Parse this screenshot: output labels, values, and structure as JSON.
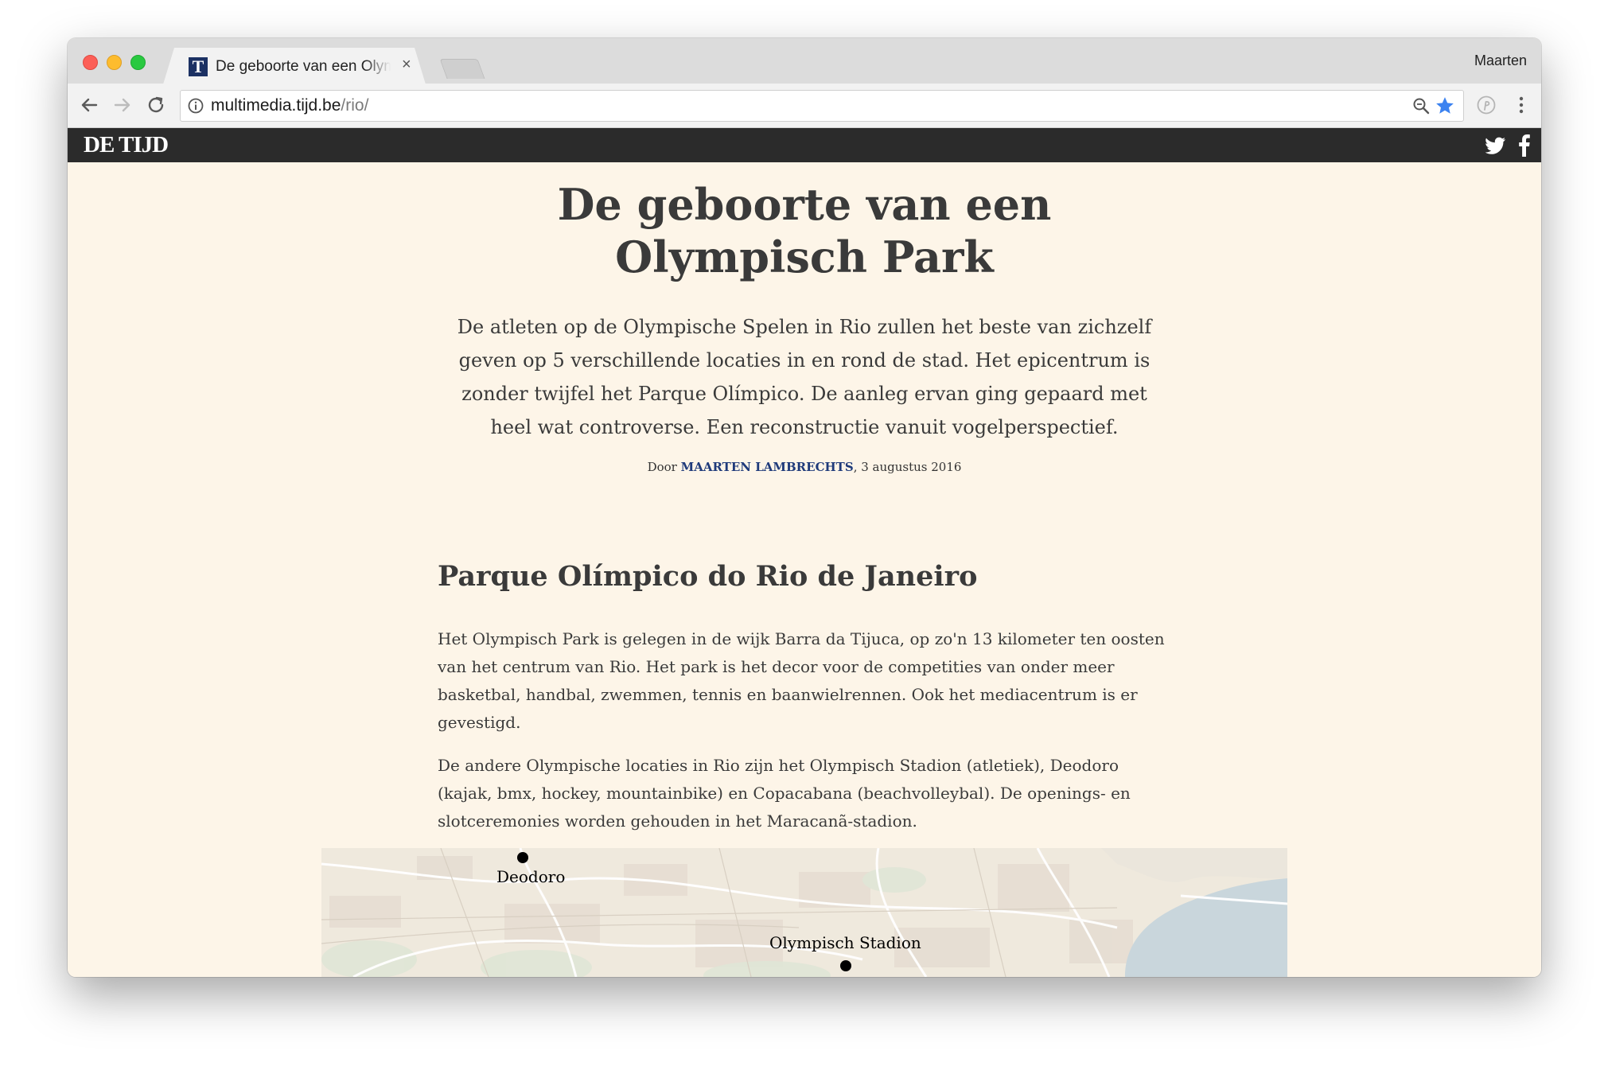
{
  "browser": {
    "tab_title": "De geboorte van een Olympisch Park",
    "tab_close": "×",
    "favicon_letter": "T",
    "profile_name": "Maarten",
    "url_host": "multimedia.tijd.be",
    "url_path": "/rio/"
  },
  "site": {
    "logo": "DE TIJD",
    "social": [
      "twitter-icon",
      "facebook-icon"
    ]
  },
  "article": {
    "headline": "De geboorte van een Olympisch Park",
    "intro": "De atleten op de Olympische Spelen in Rio zullen het beste van zichzelf geven op 5 verschillende locaties in en rond de stad. Het epicentrum is zonder twijfel het Parque Olímpico. De aanleg ervan ging gepaard met heel wat controverse. Een reconstructie vanuit vogelperspectief.",
    "byline_prefix": "Door ",
    "byline_author": "MAARTEN LAMBRECHTS",
    "byline_date": ", 3 augustus 2016",
    "section_title": "Parque Olímpico do Rio de Janeiro",
    "paragraph_1": "Het Olympisch Park is gelegen in de wijk Barra da Tijuca, op zo'n 13 kilometer ten oosten van het centrum van Rio. Het park is het decor voor de competities van onder meer basketbal, handbal, zwemmen, tennis en baanwielrennen. Ook het mediacentrum is er gevestigd.",
    "paragraph_2": "De andere Olympische locaties in Rio zijn het Olympisch Stadion (atletiek), Deodoro (kajak, bmx, hockey, mountainbike) en Copacabana (beachvolleybal). De openings- en slotceremonies worden gehouden in het Maracanã-stadion."
  },
  "map": {
    "labels": [
      "Deodoro",
      "Olympisch Stadion"
    ]
  },
  "colors": {
    "page_background": "#fdf5e8",
    "header_background": "#2b2b2b",
    "author_link": "#1e3a7a",
    "star_icon": "#3b82f0",
    "water": "#c9d6dc"
  }
}
